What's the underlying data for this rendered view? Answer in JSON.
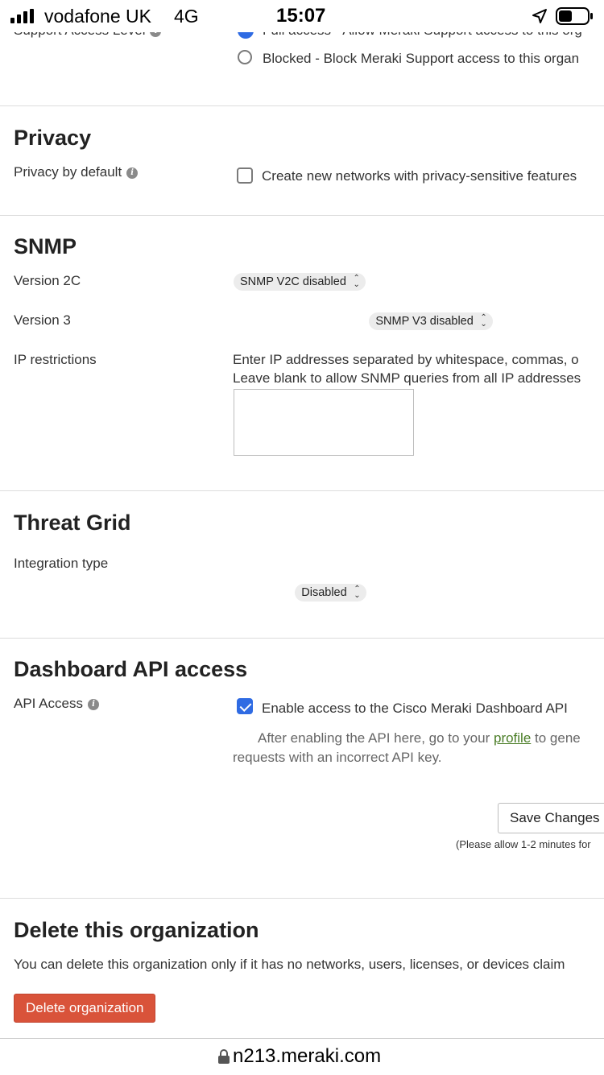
{
  "status_bar": {
    "carrier": "vodafone UK",
    "network": "4G",
    "time": "15:07"
  },
  "support_access": {
    "label": "Support Access Level",
    "option_full": "Full access - Allow Meraki Support access to this org",
    "option_blocked": "Blocked - Block Meraki Support access to this organ"
  },
  "privacy": {
    "title": "Privacy",
    "label": "Privacy by default",
    "checkbox_text": "Create new networks with privacy-sensitive features"
  },
  "snmp": {
    "title": "SNMP",
    "v2c_label": "Version 2C",
    "v2c_value": "SNMP V2C disabled",
    "v3_label": "Version 3",
    "v3_value": "SNMP V3 disabled",
    "ip_label": "IP restrictions",
    "ip_help_1": "Enter IP addresses separated by whitespace, commas, o",
    "ip_help_2": "Leave blank to allow SNMP queries from all IP addresses",
    "ip_value": ""
  },
  "threat_grid": {
    "title": "Threat Grid",
    "label": "Integration type",
    "value": "Disabled"
  },
  "dashboard_api": {
    "title": "Dashboard API access",
    "label": "API Access",
    "checkbox_text": "Enable access to the Cisco Meraki Dashboard API",
    "checked": true,
    "note_pre": "After enabling the API here, go to your",
    "note_link": "profile",
    "note_post": "to gene",
    "note_line2": "requests with an incorrect API key.",
    "save_button": "Save Changes",
    "save_note": "(Please allow 1-2 minutes for"
  },
  "delete_org": {
    "title": "Delete this organization",
    "description": "You can delete this organization only if it has no networks, users, licenses, or devices claim",
    "button": "Delete organization"
  },
  "url_bar": {
    "url": "n213.meraki.com"
  }
}
